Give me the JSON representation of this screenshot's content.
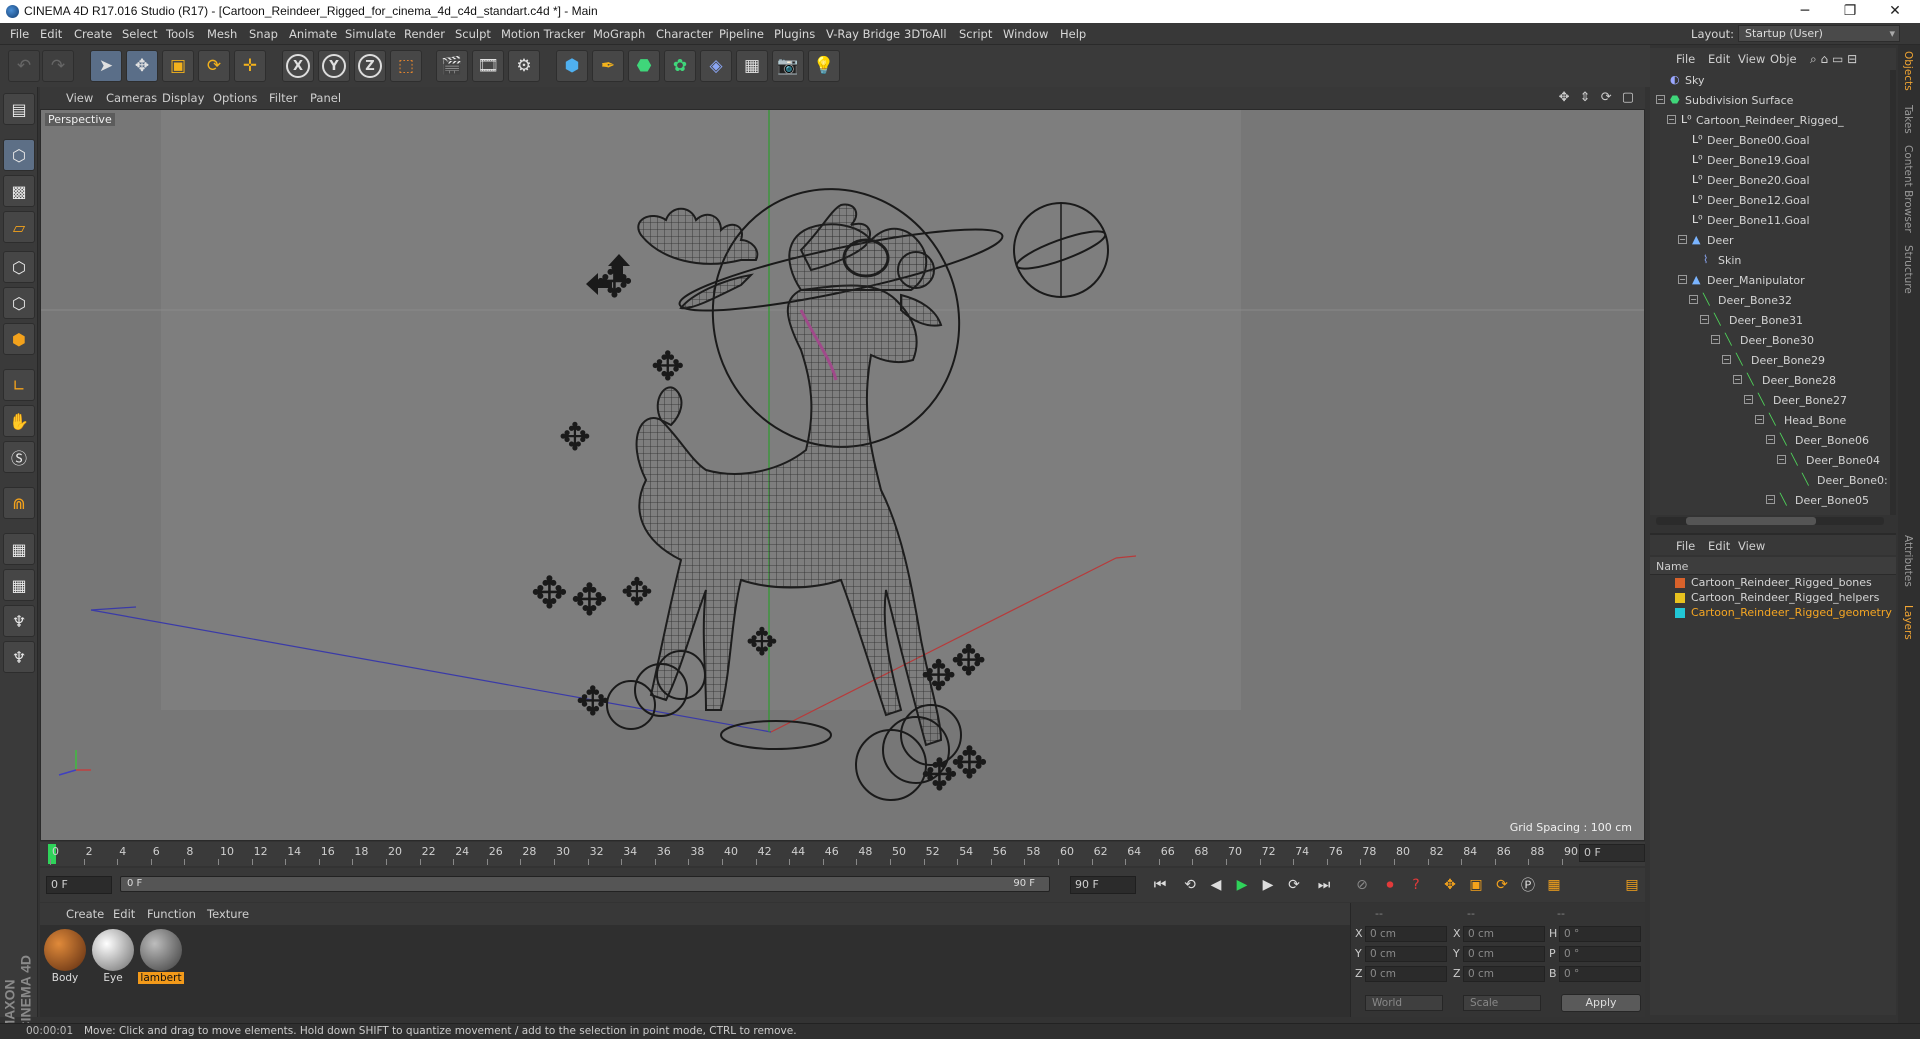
{
  "window": {
    "title": "CINEMA 4D R17.016 Studio (R17) - [Cartoon_Reindeer_Rigged_for_cinema_4d_c4d_standart.c4d *] - Main",
    "minimize": "─",
    "restore": "❐",
    "close": "✕"
  },
  "menubar": {
    "items": [
      "File",
      "Edit",
      "Create",
      "Select",
      "Tools",
      "Mesh",
      "Snap",
      "Animate",
      "Simulate",
      "Render",
      "Sculpt",
      "Motion Tracker",
      "MoGraph",
      "Character",
      "Pipeline",
      "Plugins",
      "V-Ray Bridge",
      "3DToAll",
      "Script",
      "Window",
      "Help"
    ],
    "layout_label": "Layout:",
    "layout_value": "Startup (User)"
  },
  "toolbar": {
    "icons": [
      "undo-icon",
      "redo-icon",
      "select-arrow-icon",
      "move-icon",
      "scale-icon",
      "rotate-icon",
      "live-selection-icon",
      "x-axis-icon",
      "y-axis-icon",
      "z-axis-icon",
      "coordinate-system-icon",
      "render-view-icon",
      "render-picture-viewer-icon",
      "edit-render-settings-icon",
      "cube-icon",
      "pen-spline-icon",
      "subdivision-icon",
      "array-icon",
      "deformer-icon",
      "floor-icon",
      "camera-icon",
      "light-icon"
    ],
    "axis_x": "X",
    "axis_y": "Y",
    "axis_z": "Z"
  },
  "viewport": {
    "menu": [
      "View",
      "Cameras",
      "Display",
      "Options",
      "Filter",
      "Panel"
    ],
    "label": "Perspective",
    "grid_spacing": "Grid Spacing : 100 cm",
    "nav_icons": "✥ ⇕ ⟳ ▢"
  },
  "timeline": {
    "ticks": [
      "0",
      "2",
      "4",
      "6",
      "8",
      "10",
      "12",
      "14",
      "16",
      "18",
      "20",
      "22",
      "24",
      "26",
      "28",
      "30",
      "32",
      "34",
      "36",
      "38",
      "40",
      "42",
      "44",
      "46",
      "48",
      "50",
      "52",
      "54",
      "56",
      "58",
      "60",
      "62",
      "64",
      "66",
      "68",
      "70",
      "72",
      "74",
      "76",
      "78",
      "80",
      "82",
      "84",
      "86",
      "88",
      "90"
    ],
    "current_frame": "0 F",
    "start_field": "0 F",
    "range_start": "0 F",
    "range_end": "90 F",
    "end_field": "90 F"
  },
  "transport": {
    "icons": [
      "go-to-start-icon",
      "previous-keyframe-icon",
      "previous-frame-icon",
      "play-icon",
      "next-frame-icon",
      "next-keyframe-icon",
      "go-to-end-icon",
      "record-active-icon",
      "autokey-icon",
      "keyframe-selection-icon",
      "record-position-icon",
      "record-scale-icon",
      "record-rotation-icon",
      "record-parameter-icon",
      "record-pla-icon",
      "timeline-icon"
    ]
  },
  "materials": {
    "menu": [
      "Create",
      "Edit",
      "Function",
      "Texture"
    ],
    "items": [
      {
        "name": "Body",
        "selected": false
      },
      {
        "name": "Eye",
        "selected": false
      },
      {
        "name": "lambert",
        "selected": true
      }
    ]
  },
  "coordinates": {
    "headers": [
      "--",
      "--",
      "--"
    ],
    "rows": [
      {
        "l1": "X",
        "v1": "0 cm",
        "l2": "X",
        "v2": "0 cm",
        "l3": "H",
        "v3": "0 °"
      },
      {
        "l1": "Y",
        "v1": "0 cm",
        "l2": "Y",
        "v2": "0 cm",
        "l3": "P",
        "v3": "0 °"
      },
      {
        "l1": "Z",
        "v1": "0 cm",
        "l2": "Z",
        "v2": "0 cm",
        "l3": "B",
        "v3": "0 °"
      }
    ],
    "space": "World",
    "mode": "Scale",
    "apply": "Apply"
  },
  "status": {
    "time": "00:00:01",
    "message": "Move: Click and drag to move elements. Hold down SHIFT to quantize movement / add to the selection in point mode, CTRL to remove."
  },
  "object_manager": {
    "menu": [
      "File",
      "Edit",
      "View",
      "Obje"
    ],
    "objects": [
      {
        "name": "Sky",
        "depth": 0,
        "icon": "sky-icon",
        "exp": ""
      },
      {
        "name": "Subdivision Surface",
        "depth": 0,
        "icon": "subdivision-icon",
        "exp": "-"
      },
      {
        "name": "Cartoon_Reindeer_Rigged_",
        "depth": 1,
        "icon": "null-object-icon",
        "exp": "-"
      },
      {
        "name": "Deer_Bone00.Goal",
        "depth": 2,
        "icon": "null-object-icon",
        "exp": ""
      },
      {
        "name": "Deer_Bone19.Goal",
        "depth": 2,
        "icon": "null-object-icon",
        "exp": ""
      },
      {
        "name": "Deer_Bone20.Goal",
        "depth": 2,
        "icon": "null-object-icon",
        "exp": ""
      },
      {
        "name": "Deer_Bone12.Goal",
        "depth": 2,
        "icon": "null-object-icon",
        "exp": ""
      },
      {
        "name": "Deer_Bone11.Goal",
        "depth": 2,
        "icon": "null-object-icon",
        "exp": ""
      },
      {
        "name": "Deer",
        "depth": 2,
        "icon": "polygon-object-icon",
        "exp": "-"
      },
      {
        "name": "Skin",
        "depth": 3,
        "icon": "skin-deformer-icon",
        "exp": ""
      },
      {
        "name": "Deer_Manipulator",
        "depth": 2,
        "icon": "polygon-object-icon",
        "exp": "-"
      },
      {
        "name": "Deer_Bone32",
        "depth": 3,
        "icon": "joint-icon",
        "exp": "-"
      },
      {
        "name": "Deer_Bone31",
        "depth": 4,
        "icon": "joint-icon",
        "exp": "-"
      },
      {
        "name": "Deer_Bone30",
        "depth": 5,
        "icon": "joint-icon",
        "exp": "-"
      },
      {
        "name": "Deer_Bone29",
        "depth": 6,
        "icon": "joint-icon",
        "exp": "-"
      },
      {
        "name": "Deer_Bone28",
        "depth": 7,
        "icon": "joint-icon",
        "exp": "-"
      },
      {
        "name": "Deer_Bone27",
        "depth": 8,
        "icon": "joint-icon",
        "exp": "-"
      },
      {
        "name": "Head_Bone",
        "depth": 9,
        "icon": "joint-icon",
        "exp": "-"
      },
      {
        "name": "Deer_Bone06",
        "depth": 10,
        "icon": "joint-icon",
        "exp": "-"
      },
      {
        "name": "Deer_Bone04",
        "depth": 11,
        "icon": "joint-icon",
        "exp": "-"
      },
      {
        "name": "Deer_Bone0:",
        "depth": 12,
        "icon": "joint-icon",
        "exp": ""
      },
      {
        "name": "Deer_Bone05",
        "depth": 10,
        "icon": "joint-icon",
        "exp": "-"
      }
    ]
  },
  "layer_manager": {
    "menu": [
      "File",
      "Edit",
      "View"
    ],
    "column": "Name",
    "layers": [
      {
        "name": "Cartoon_Reindeer_Rigged_bones",
        "color": "#d9622b",
        "selected": false
      },
      {
        "name": "Cartoon_Reindeer_Rigged_helpers",
        "color": "#e8c21f",
        "selected": false
      },
      {
        "name": "Cartoon_Reindeer_Rigged_geometry",
        "color": "#22c7d6",
        "selected": true
      }
    ]
  },
  "side_tabs": [
    "Objects",
    "Takes",
    "Content Browser",
    "Structure",
    "Attributes",
    "Layers"
  ],
  "brand": "MAXON CINEMA 4D",
  "colors": {
    "accent_orange": "#f39a1a",
    "viewport_bg": "#777777",
    "play_green": "#2fd35a"
  }
}
